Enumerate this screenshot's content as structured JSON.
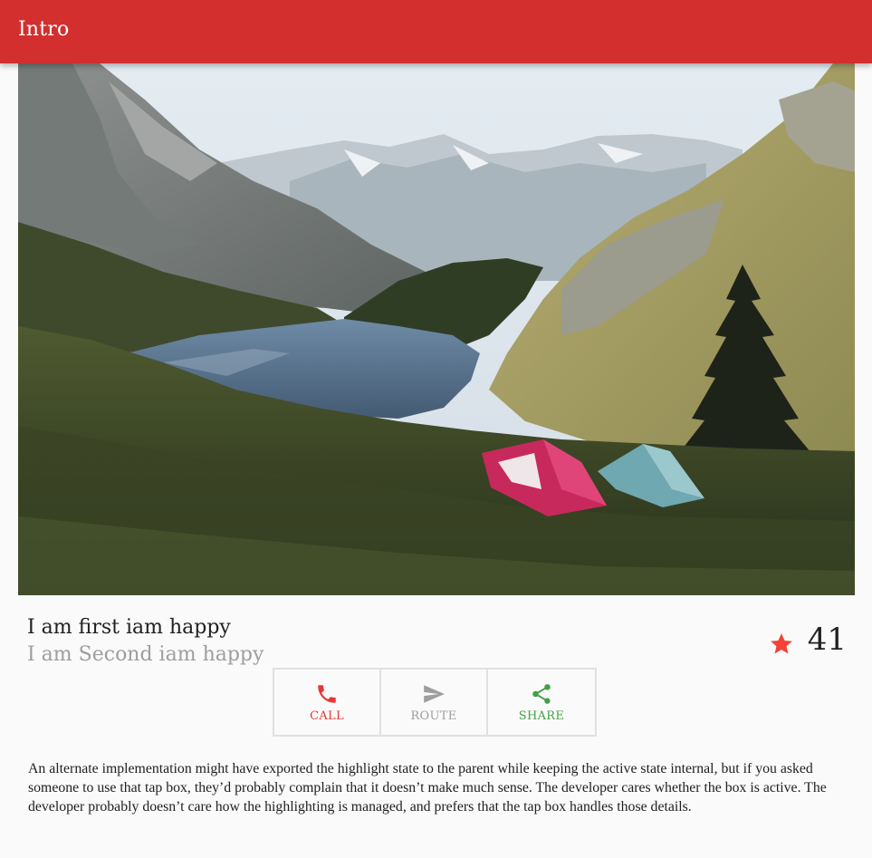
{
  "appbar": {
    "title": "Intro"
  },
  "hero": {
    "alt": "Mountain lake with two tents on a grassy hillside"
  },
  "card": {
    "title": "I am first iam happy",
    "subtitle": "I am Second iam happy",
    "rating_count": "41",
    "rating_icon": "star-icon"
  },
  "actions": [
    {
      "label": "CALL",
      "icon": "phone-icon",
      "color": "#e53935"
    },
    {
      "label": "ROUTE",
      "icon": "send-icon",
      "color": "#9e9e9e"
    },
    {
      "label": "SHARE",
      "icon": "share-icon",
      "color": "#43a047"
    }
  ],
  "description": "An alternate implementation might have exported the highlight state to the parent while keeping the active state internal, but if you asked someone to use that tap box, they’d probably complain that it doesn’t make much sense. The developer cares whether the box is active. The developer probably doesn’t care how the highlighting is managed, and prefers that the tap box handles those details.",
  "colors": {
    "appbar": "#d32f2f",
    "star": "#f44336",
    "call": "#e53935",
    "route": "#9e9e9e",
    "share": "#43a047"
  }
}
